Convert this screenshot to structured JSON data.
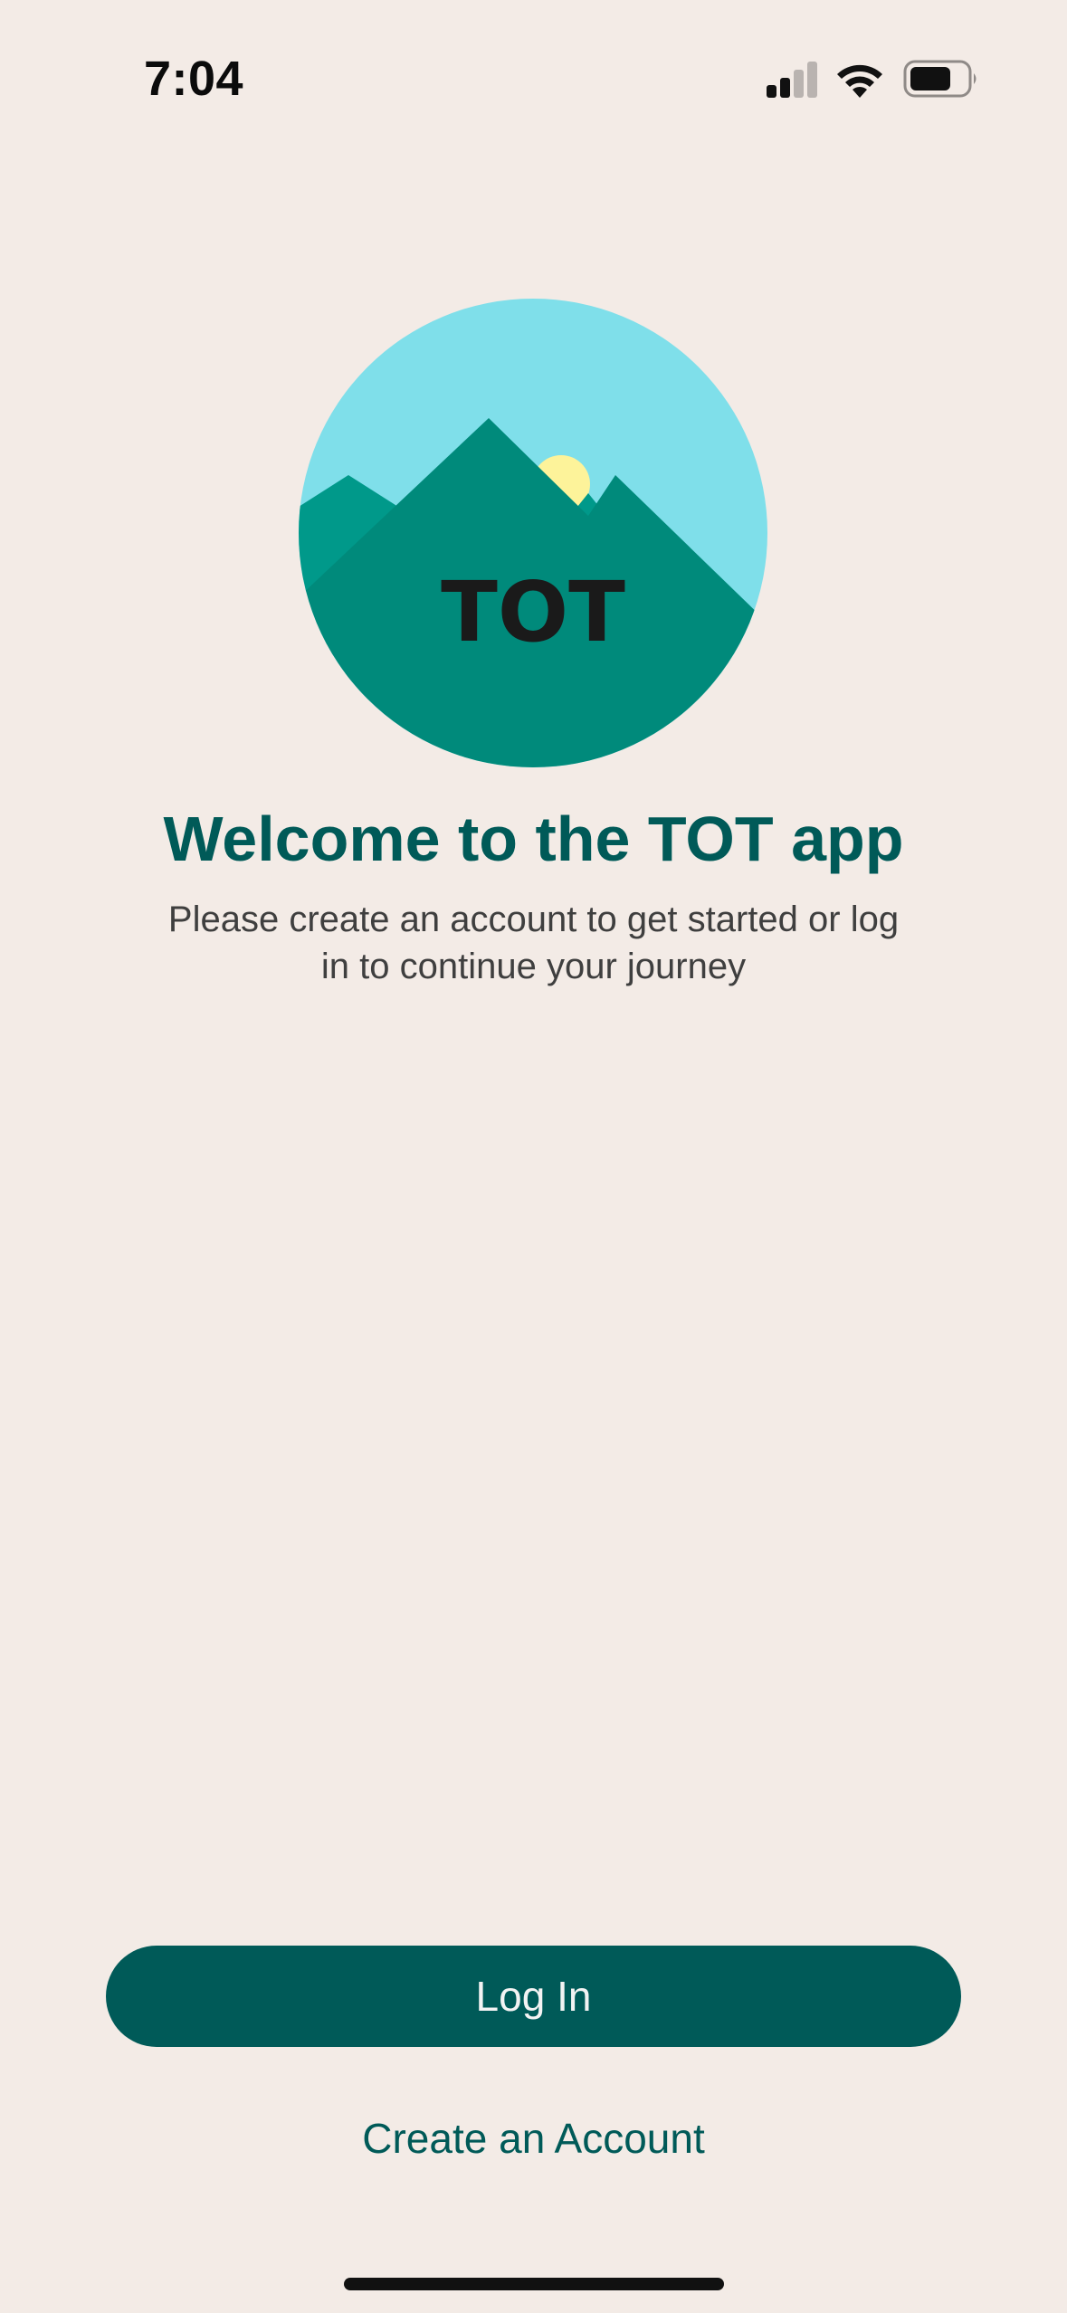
{
  "status_bar": {
    "time": "7:04",
    "icons": [
      "cellular-signal-icon",
      "wifi-icon",
      "battery-icon"
    ]
  },
  "logo": {
    "text": "TOT",
    "colors": {
      "sky": "#7fdfea",
      "sun": "#fdf39a",
      "mountain_main": "#008a7b",
      "mountain_side": "#00998a",
      "text": "#1a1a1a"
    }
  },
  "welcome": {
    "title": "Welcome to the TOT app",
    "subtitle_line1": "Please create an account to get started or log",
    "subtitle_line2": "in to continue your journey"
  },
  "actions": {
    "login_label": "Log In",
    "create_account_label": "Create an Account"
  },
  "theme": {
    "background": "#f3ebe6",
    "primary": "#005a58",
    "subtitle_text": "#3f3f3f"
  }
}
